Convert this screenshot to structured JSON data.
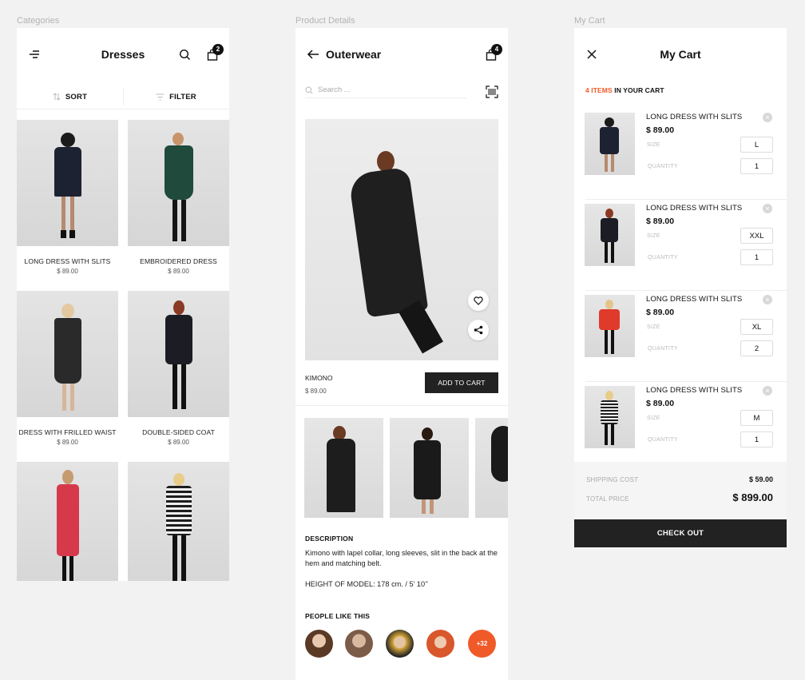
{
  "frames": {
    "categories_label": "Categories",
    "details_label": "Product Details",
    "cart_label": "My Cart"
  },
  "categories": {
    "title": "Dresses",
    "bag_count": "2",
    "sort_label": "SORT",
    "filter_label": "FILTER",
    "products": [
      {
        "name": "LONG DRESS WITH SLITS",
        "price": "$ 89.00"
      },
      {
        "name": "EMBROIDERED DRESS",
        "price": "$ 89.00"
      },
      {
        "name": "DRESS WITH FRILLED WAIST",
        "price": "$ 89.00"
      },
      {
        "name": "DOUBLE-SIDED COAT",
        "price": "$ 89.00"
      }
    ]
  },
  "details": {
    "title": "Outerwear",
    "bag_count": "4",
    "search_placeholder": "Search ...",
    "product_name": "KIMONO",
    "product_price": "$ 89.00",
    "add_to_cart": "ADD TO CART",
    "description_title": "DESCRIPTION",
    "description_text": "Kimono with lapel collar, long sleeves, slit in the back at the hem and matching belt.",
    "model_height": "HEIGHT OF MODEL: 178 cm. / 5’ 10’’",
    "people_title": "PEOPLE LIKE THIS",
    "people_more": "+32"
  },
  "cart": {
    "title": "My Cart",
    "count_accent": "4 ITEMS",
    "count_rest": " IN YOUR CART",
    "size_label": "SIZE",
    "quantity_label": "QUANTITY",
    "items": [
      {
        "name": "LONG DRESS WITH SLITS",
        "price": "$ 89.00",
        "size": "L",
        "qty": "1"
      },
      {
        "name": "LONG DRESS WITH SLITS",
        "price": "$ 89.00",
        "size": "XXL",
        "qty": "1"
      },
      {
        "name": "LONG DRESS WITH SLITS",
        "price": "$ 89.00",
        "size": "XL",
        "qty": "2"
      },
      {
        "name": "LONG DRESS WITH SLITS",
        "price": "$ 89.00",
        "size": "M",
        "qty": "1"
      }
    ],
    "shipping_label": "SHIPPING COST",
    "shipping_value": "$ 59.00",
    "total_label": "TOTAL PRICE",
    "total_value": "$ 899.00",
    "checkout_label": "CHECK OUT"
  },
  "colors": {
    "accent": "#f05a28",
    "dark": "#222222"
  }
}
